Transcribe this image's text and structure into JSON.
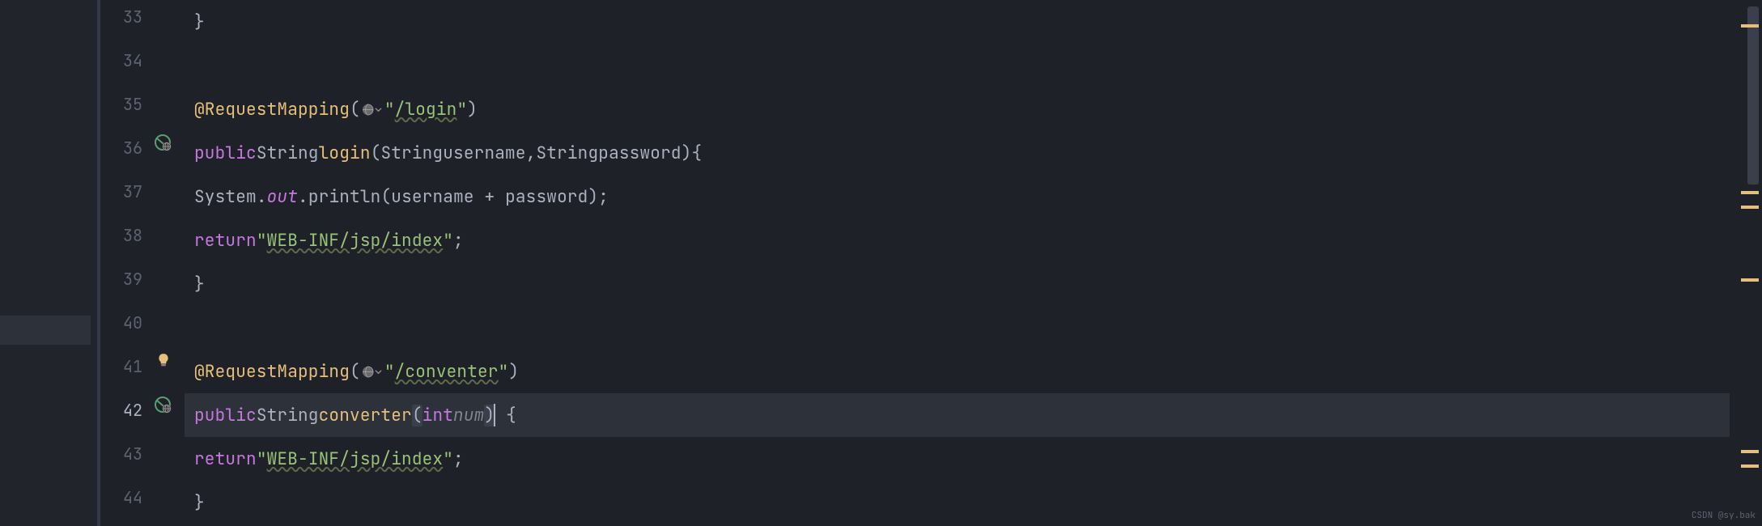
{
  "lines": {
    "33": {
      "num": "33",
      "brace": "}"
    },
    "34": {
      "num": "34"
    },
    "35": {
      "num": "35",
      "ann": "@RequestMapping",
      "lp": "(",
      "str1": "\"",
      "path": "/login",
      "str2": "\"",
      "rp": ")"
    },
    "36": {
      "num": "36",
      "kw": "public",
      "type": "String",
      "fn": "login",
      "sig_open": "(",
      "t1": "String",
      "p1": "username",
      "comma": ",",
      "t2": "String",
      "p2": "password",
      "sig_close": ")",
      "brace": "{"
    },
    "37": {
      "num": "37",
      "sys": "System",
      "dot1": ".",
      "out": "out",
      "dot2": ".",
      "call": "println",
      "open": "(",
      "a1": "username",
      "plus": " + ",
      "a2": "password",
      "close": ")",
      "semi": ";"
    },
    "38": {
      "num": "38",
      "ret": "return",
      "q1": "\"",
      "val": "WEB-INF/jsp/index",
      "q2": "\"",
      "semi": ";"
    },
    "39": {
      "num": "39",
      "brace": "}"
    },
    "40": {
      "num": "40"
    },
    "41": {
      "num": "41",
      "ann": "@RequestMapping",
      "lp": "(",
      "str1": "\"",
      "path": "/conventer",
      "str2": "\"",
      "rp": ")"
    },
    "42": {
      "num": "42",
      "kw": "public",
      "type": "String",
      "fn": "converter",
      "sig_open": "(",
      "t1": "int",
      "p1": "num",
      "sig_close": ")",
      "brace": " {"
    },
    "43": {
      "num": "43",
      "ret": "return",
      "q1": "\"",
      "val": "WEB-INF/jsp/index",
      "q2": "\"",
      "semi": ";"
    },
    "44": {
      "num": "44",
      "brace": "}"
    }
  },
  "watermark": "CSDN @sy.bak"
}
